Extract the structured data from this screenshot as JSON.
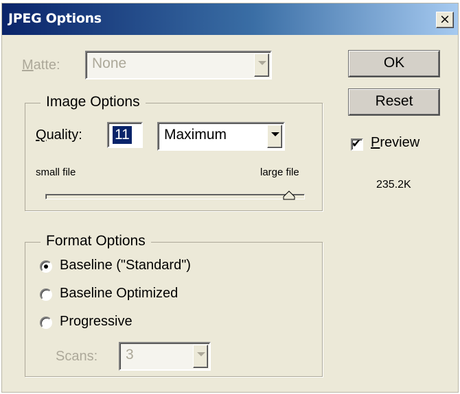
{
  "window": {
    "title": "JPEG Options",
    "close_glyph": "×"
  },
  "matte": {
    "label_prefix": "M",
    "label_rest": "atte:",
    "value": "None",
    "enabled": false
  },
  "image_options": {
    "group_label": "Image Options",
    "quality_label_prefix": "Q",
    "quality_label_rest": "uality:",
    "quality_value": "11",
    "quality_preset": "Maximum",
    "small_file_label": "small file",
    "large_file_label": "large file",
    "slider_fraction": 0.94
  },
  "format_options": {
    "group_label": "Format Options",
    "options": [
      {
        "label": "Baseline (\"Standard\")",
        "checked": true
      },
      {
        "label": "Baseline Optimized",
        "checked": false
      },
      {
        "label": "Progressive",
        "checked": false
      }
    ],
    "scans_label": "Scans:",
    "scans_value": "3",
    "scans_enabled": false
  },
  "buttons": {
    "ok": "OK",
    "reset": "Reset"
  },
  "preview": {
    "label_prefix": "P",
    "label_rest": "review",
    "checked": true,
    "tick_glyph": "✔",
    "file_size": "235.2K"
  },
  "icons": {
    "close": "close-icon",
    "dropdown": "chevron-down-icon",
    "slider": "slider-thumb-icon"
  }
}
